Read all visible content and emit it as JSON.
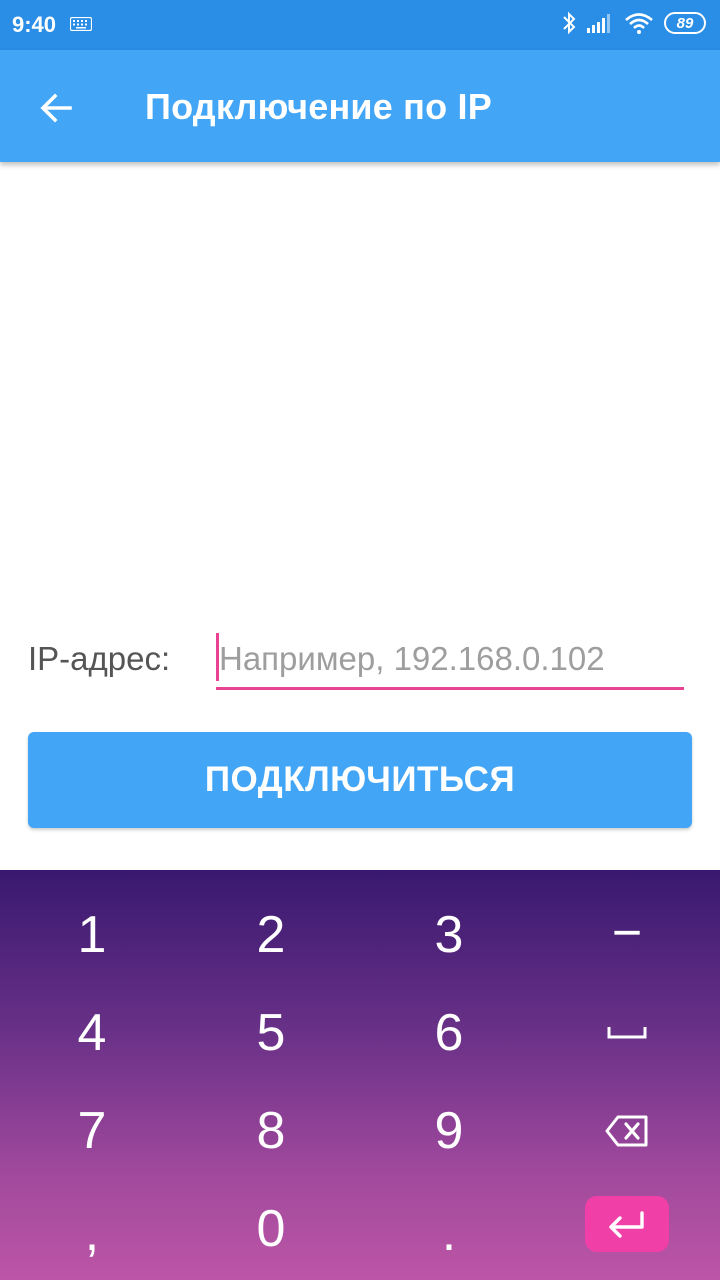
{
  "status_bar": {
    "time": "9:40",
    "battery": "89",
    "icons": [
      "keyboard-icon",
      "bluetooth-icon",
      "signal-icon",
      "wifi-icon",
      "battery-icon"
    ]
  },
  "app_bar": {
    "title": "Подключение по IP",
    "back_icon": "arrow-left-icon",
    "color": "#42a5f5"
  },
  "form": {
    "ip_label": "IP-адрес:",
    "ip_placeholder": "Например, 192.168.0.102",
    "ip_value": "",
    "connect_label": "ПОДКЛЮЧИТЬСЯ",
    "accent_color": "#e84393"
  },
  "keyboard": {
    "rows": [
      [
        "1",
        "2",
        "3",
        "−"
      ],
      [
        "4",
        "5",
        "6",
        "space-icon"
      ],
      [
        "7",
        "8",
        "9",
        "backspace-icon"
      ],
      [
        ",",
        "0",
        ".",
        "enter-icon"
      ]
    ]
  }
}
